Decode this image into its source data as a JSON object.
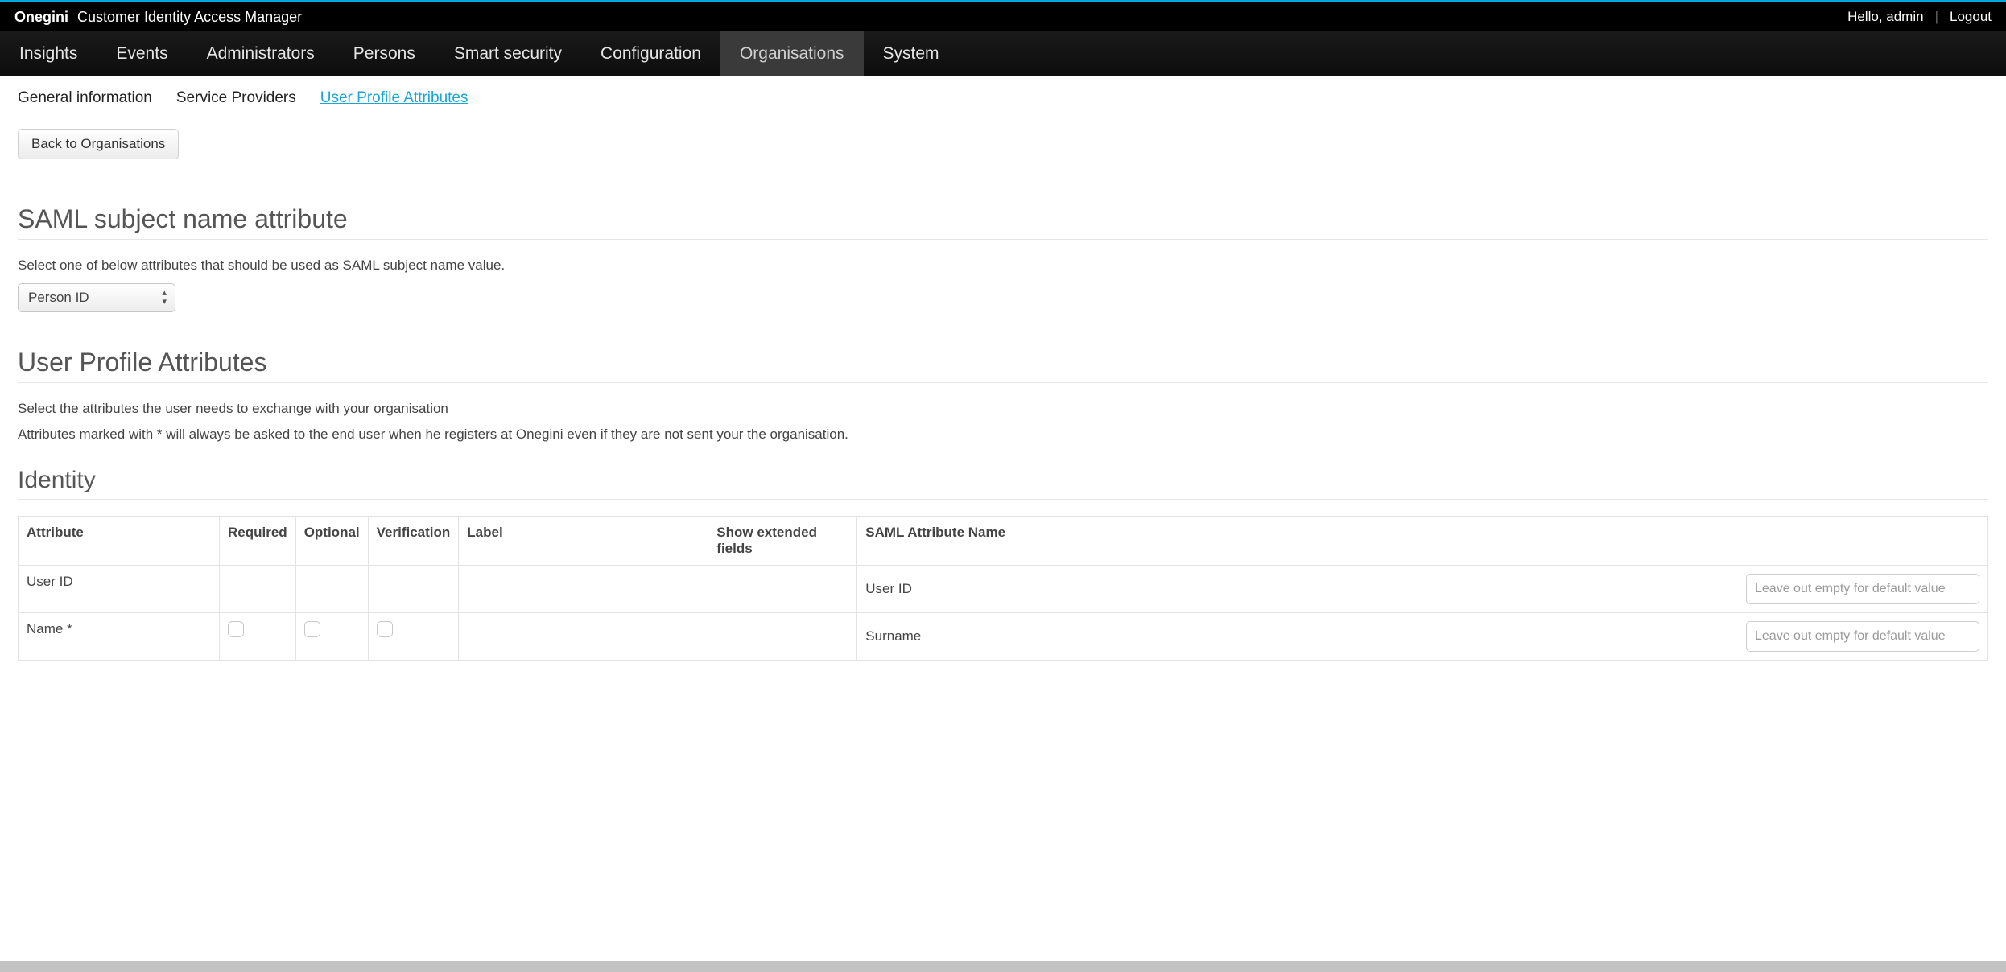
{
  "brand": {
    "strong": "Onegini",
    "rest": "Customer Identity Access Manager"
  },
  "user": {
    "greeting": "Hello, admin",
    "logout": "Logout"
  },
  "nav": {
    "items": [
      "Insights",
      "Events",
      "Administrators",
      "Persons",
      "Smart security",
      "Configuration",
      "Organisations",
      "System"
    ],
    "active_index": 6
  },
  "subtabs": {
    "items": [
      "General information",
      "Service Providers",
      "User Profile Attributes"
    ],
    "active_index": 2
  },
  "back_button": "Back to Organisations",
  "section1": {
    "title": "SAML subject name attribute",
    "desc": "Select one of below attributes that should be used as SAML subject name value.",
    "selected": "Person ID"
  },
  "section2": {
    "title": "User Profile Attributes",
    "desc1": "Select the attributes the user needs to exchange with your organisation",
    "desc2": "Attributes marked with * will always be asked to the end user when he registers at Onegini even if they are not sent your the organisation."
  },
  "identity": {
    "title": "Identity",
    "columns": [
      "Attribute",
      "Required",
      "Optional",
      "Verification",
      "Label",
      "Show extended fields",
      "SAML Attribute Name"
    ],
    "rows": [
      {
        "attribute": "User ID",
        "required": null,
        "optional": null,
        "verification": null,
        "saml_label": "User ID",
        "placeholder": "Leave out empty for default value"
      },
      {
        "attribute": "Name *",
        "required": false,
        "optional": false,
        "verification": false,
        "saml_label": "Surname",
        "placeholder": "Leave out empty for default value"
      }
    ]
  }
}
